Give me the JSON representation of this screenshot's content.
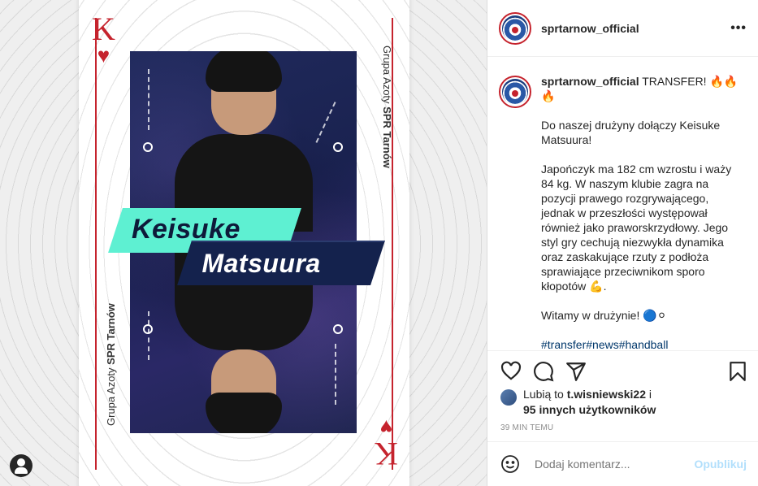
{
  "card": {
    "rank": "K",
    "suit_symbol": "♥",
    "side_text_prefix": "Grupa Azoty",
    "side_text_bold": "SPR Tarnów",
    "first_name": "Keisuke",
    "last_name": "Matsuura",
    "accent_color": "#5ef0d2",
    "red_color": "#c5232d"
  },
  "header": {
    "username": "sprtarnow_official",
    "more_icon": "more-horizontal-icon"
  },
  "caption": {
    "username": "sprtarnow_official",
    "headline": "TRANSFER! 🔥🔥🔥",
    "paragraphs": [
      "Do naszej drużyny dołączy Keisuke Matsuura!",
      "Japończyk ma 182 cm wzrostu i waży 84 kg. W naszym klubie zagra na pozycji prawego rozgrywającego, jednak w przeszłości występował również jako praworskrzydłowy. Jego styl gry cechują niezwykła dynamika oraz zaskakujące rzuty z podłoża sprawiające przeciwnikom sporo kłopotów 💪.",
      "Witamy w drużynie! 🔵⚪"
    ],
    "hashtags": "#transfer#news#handball"
  },
  "actions": {
    "like_icon": "heart-icon",
    "comment_icon": "comment-icon",
    "share_icon": "share-icon",
    "save_icon": "bookmark-icon"
  },
  "likes": {
    "prefix": "Lubią to ",
    "user": "t.wisniewski22",
    "middle": " i",
    "others": "95 innych użytkowników"
  },
  "time": "39 MIN TEMU",
  "comment_bar": {
    "emoji_icon": "emoji-icon",
    "placeholder": "Dodaj komentarz...",
    "post_label": "Opublikuj"
  }
}
